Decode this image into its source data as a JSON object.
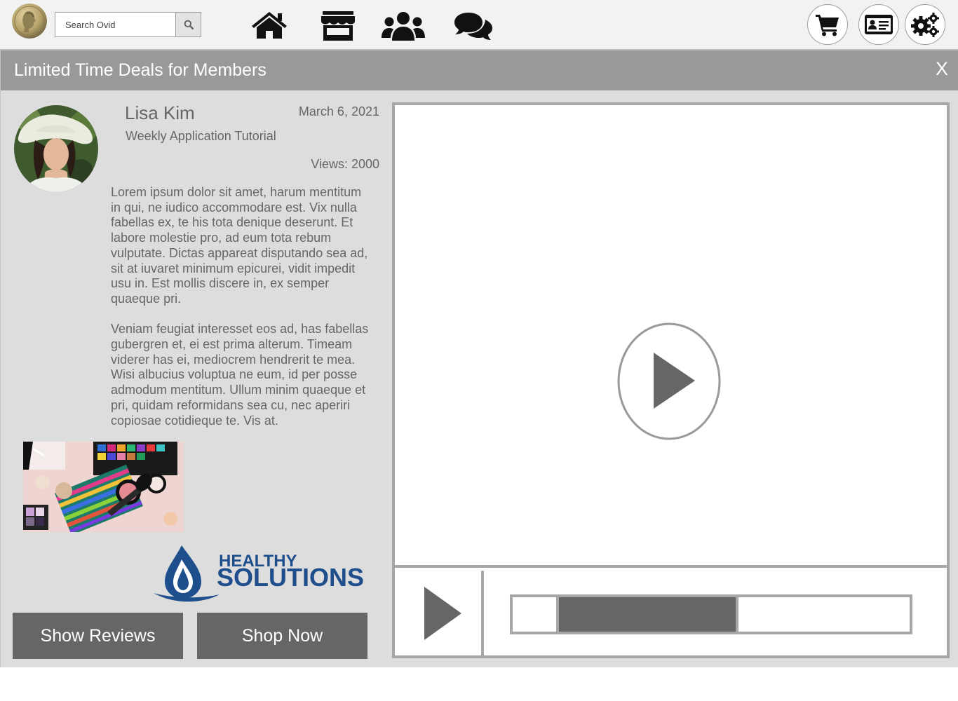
{
  "search": {
    "placeholder": "Search Ovid"
  },
  "nav": {
    "icons": [
      "home-icon",
      "store-icon",
      "users-icon",
      "chat-icon"
    ],
    "right_icons": [
      "cart-icon",
      "id-card-icon",
      "settings-icon"
    ]
  },
  "modal": {
    "title": "Limited Time Deals for Members",
    "close_label": "X"
  },
  "post": {
    "author": "Lisa Kim",
    "subtitle": "Weekly Application Tutorial",
    "date": "March 6, 2021",
    "views": "Views: 2000",
    "paragraphs": [
      "Lorem ipsum dolor sit amet, harum mentitum in qui, ne iudico accommodare est. Vix nulla fabellas ex, te his tota denique deserunt. Et labore molestie pro, ad eum tota rebum vulputate. Dictas appareat disputando sea ad, sit at iuvaret minimum epicurei, vidit impedit usu in. Est mollis discere in, ex semper quaeque pri.",
      "Veniam feugiat interesset eos ad, has fabellas gubergren et, ei est prima alterum. Timeam viderer has ei, mediocrem hendrerit te mea. Wisi albucius voluptua ne eum, id per posse admodum mentitum. Ullum minim quaeque et pri, quidam reformidans sea cu, nec aperiri copiosae cotidieque te. Vis at."
    ]
  },
  "brand": {
    "line1": "HEALTHY",
    "line2": "SOLUTIONS"
  },
  "buttons": {
    "reviews": "Show Reviews",
    "shop": "Shop Now"
  },
  "player": {
    "buffered_start": 0.11,
    "buffered_end": 0.57
  },
  "colors": {
    "header": "#999999",
    "panel": "#dddddd",
    "button": "#666666",
    "brand_blue": "#1f4e8c"
  }
}
